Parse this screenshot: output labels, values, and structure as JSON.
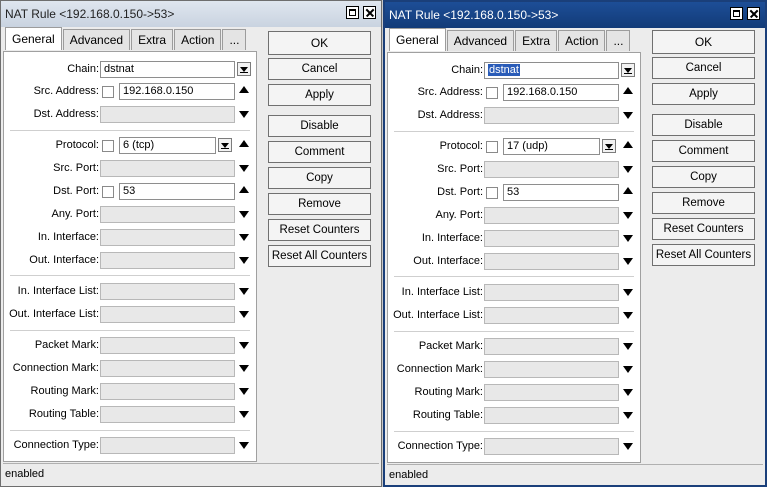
{
  "windows": [
    {
      "title": "NAT Rule <192.168.0.150->53>",
      "tabs": [
        "General",
        "Advanced",
        "Extra",
        "Action",
        "..."
      ],
      "fields": {
        "chain": {
          "label": "Chain:",
          "value": "dstnat"
        },
        "src_address": {
          "label": "Src. Address:",
          "value": "192.168.0.150"
        },
        "dst_address": {
          "label": "Dst. Address:",
          "value": ""
        },
        "protocol": {
          "label": "Protocol:",
          "value": "6 (tcp)"
        },
        "src_port": {
          "label": "Src. Port:",
          "value": ""
        },
        "dst_port": {
          "label": "Dst. Port:",
          "value": "53"
        },
        "any_port": {
          "label": "Any. Port:",
          "value": ""
        },
        "in_interface": {
          "label": "In. Interface:",
          "value": ""
        },
        "out_interface": {
          "label": "Out. Interface:",
          "value": ""
        },
        "in_interface_list": {
          "label": "In. Interface List:",
          "value": ""
        },
        "out_interface_list": {
          "label": "Out. Interface List:",
          "value": ""
        },
        "packet_mark": {
          "label": "Packet Mark:",
          "value": ""
        },
        "connection_mark": {
          "label": "Connection Mark:",
          "value": ""
        },
        "routing_mark": {
          "label": "Routing Mark:",
          "value": ""
        },
        "routing_table": {
          "label": "Routing Table:",
          "value": ""
        },
        "connection_type": {
          "label": "Connection Type:",
          "value": ""
        }
      },
      "buttons": [
        "OK",
        "Cancel",
        "Apply",
        "Disable",
        "Comment",
        "Copy",
        "Remove",
        "Reset Counters",
        "Reset All Counters"
      ],
      "status": "enabled"
    },
    {
      "title": "NAT Rule <192.168.0.150->53>",
      "tabs": [
        "General",
        "Advanced",
        "Extra",
        "Action",
        "..."
      ],
      "fields": {
        "chain": {
          "label": "Chain:",
          "value": "dstnat"
        },
        "src_address": {
          "label": "Src. Address:",
          "value": "192.168.0.150"
        },
        "dst_address": {
          "label": "Dst. Address:",
          "value": ""
        },
        "protocol": {
          "label": "Protocol:",
          "value": "17 (udp)"
        },
        "src_port": {
          "label": "Src. Port:",
          "value": ""
        },
        "dst_port": {
          "label": "Dst. Port:",
          "value": "53"
        },
        "any_port": {
          "label": "Any. Port:",
          "value": ""
        },
        "in_interface": {
          "label": "In. Interface:",
          "value": ""
        },
        "out_interface": {
          "label": "Out. Interface:",
          "value": ""
        },
        "in_interface_list": {
          "label": "In. Interface List:",
          "value": ""
        },
        "out_interface_list": {
          "label": "Out. Interface List:",
          "value": ""
        },
        "packet_mark": {
          "label": "Packet Mark:",
          "value": ""
        },
        "connection_mark": {
          "label": "Connection Mark:",
          "value": ""
        },
        "routing_mark": {
          "label": "Routing Mark:",
          "value": ""
        },
        "routing_table": {
          "label": "Routing Table:",
          "value": ""
        },
        "connection_type": {
          "label": "Connection Type:",
          "value": ""
        }
      },
      "buttons": [
        "OK",
        "Cancel",
        "Apply",
        "Disable",
        "Comment",
        "Copy",
        "Remove",
        "Reset Counters",
        "Reset All Counters"
      ],
      "status": "enabled"
    }
  ],
  "colors": {
    "active_title": "#123b78",
    "selection": "#2a5cb8"
  }
}
